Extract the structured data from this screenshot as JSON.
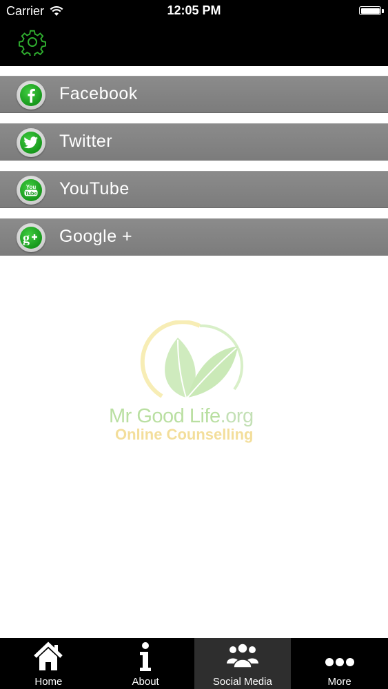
{
  "status_bar": {
    "carrier": "Carrier",
    "time": "12:05 PM",
    "battery_level": 1.0
  },
  "nav_bar": {
    "settings_icon": "gear-icon",
    "accent_color": "#2fae2f"
  },
  "social_links": [
    {
      "label": "Facebook",
      "icon": "facebook-icon"
    },
    {
      "label": "Twitter",
      "icon": "twitter-icon"
    },
    {
      "label": "YouTube",
      "icon": "youtube-icon"
    },
    {
      "label": "Google +",
      "icon": "google-plus-icon"
    }
  ],
  "logo": {
    "name_part1": "Mr Good Life",
    "name_part2": ".org",
    "tagline": "Online Counselling"
  },
  "tab_bar": {
    "active": "Social Media",
    "tabs": [
      {
        "label": "Home",
        "icon": "home-icon"
      },
      {
        "label": "About",
        "icon": "info-icon"
      },
      {
        "label": "Social Media",
        "icon": "people-icon"
      },
      {
        "label": "More",
        "icon": "more-icon"
      }
    ]
  },
  "colors": {
    "row_background": "#838383",
    "icon_green": "#1fa82a",
    "tab_active_background": "#2e2e2e"
  }
}
